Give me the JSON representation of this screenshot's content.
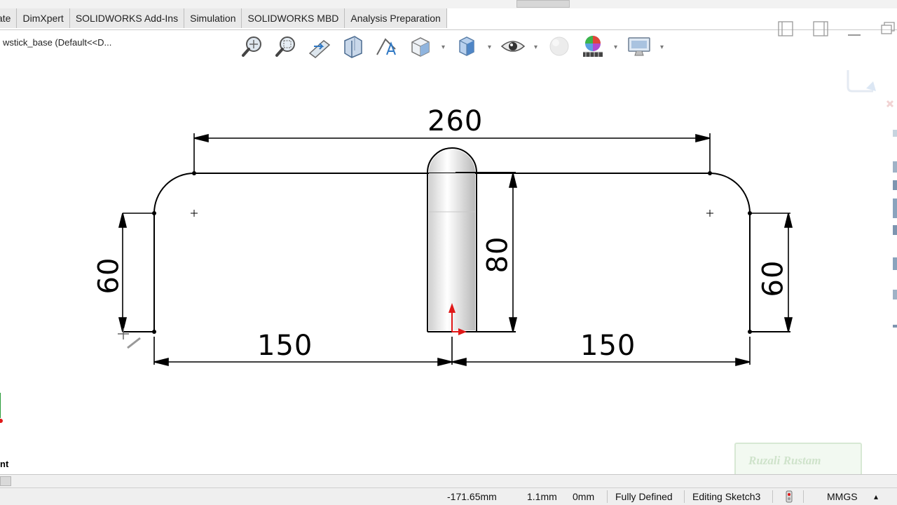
{
  "command_tabs": [
    "ate",
    "DimXpert",
    "SOLIDWORKS Add-Ins",
    "Simulation",
    "SOLIDWORKS MBD",
    "Analysis Preparation"
  ],
  "document_title": "wstick_base  (Default<<D...",
  "heads_up_icons": [
    "zoom-to-fit-icon",
    "zoom-to-area-icon",
    "previous-view-icon",
    "section-view-icon",
    "dynamic-annotation-icon",
    "view-orientation-icon",
    "display-style-icon",
    "hide-show-icon",
    "edit-appearance-icon",
    "apply-scene-icon",
    "view-settings-icon"
  ],
  "dimensions": {
    "overall_width": "260",
    "left_height": "60",
    "right_height": "60",
    "boss_height": "80",
    "left_width": "150",
    "right_width": "150"
  },
  "watermark_text": "Ruzali Rustam",
  "left_panel_cut_text": "nt",
  "status_bar": {
    "x_coord": "-171.65mm",
    "y_coord": "1.1mm",
    "z_coord": "0mm",
    "sketch_state": "Fully Defined",
    "editing": "Editing Sketch3",
    "units": "MMGS",
    "units_caret": "▴"
  },
  "colors": {
    "sketch_line": "#000000",
    "origin_red": "#e01818",
    "tab_bg": "#e9e9e9",
    "status_bg": "#efefef"
  }
}
